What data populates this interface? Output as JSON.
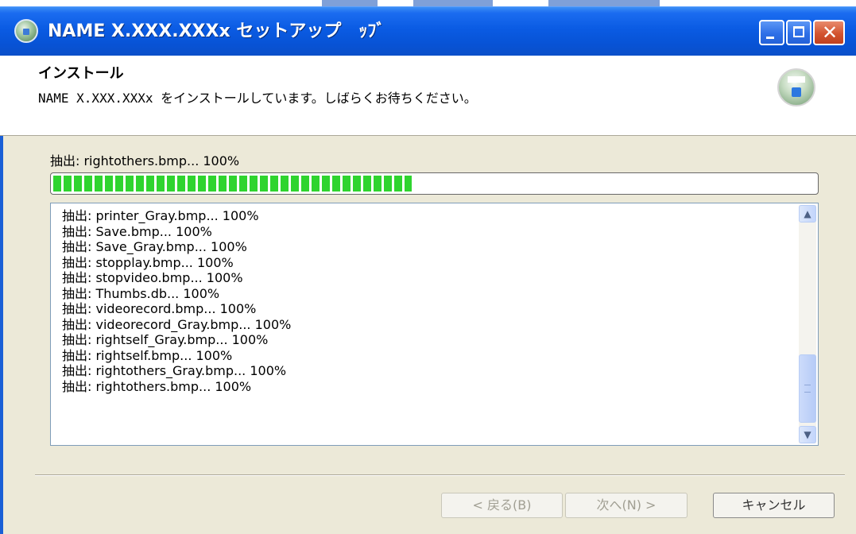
{
  "window": {
    "title": "NAME X.XXX.XXXx セットアップ　ｯﾌﾞ"
  },
  "header": {
    "title": "インストール",
    "subtitle": "NAME X.XXX.XXXx をインストールしています。しばらくお待ちください。"
  },
  "progress": {
    "status": "抽出: rightothers.bmp... 100%",
    "fraction": 0.47
  },
  "log": {
    "lines": [
      "抽出: printer_Gray.bmp... 100%",
      "抽出: Save.bmp... 100%",
      "抽出: Save_Gray.bmp... 100%",
      "抽出: stopplay.bmp... 100%",
      "抽出: stopvideo.bmp... 100%",
      "抽出: Thumbs.db... 100%",
      "抽出: videorecord.bmp... 100%",
      "抽出: videorecord_Gray.bmp... 100%",
      "抽出: rightself_Gray.bmp... 100%",
      "抽出: rightself.bmp... 100%",
      "抽出: rightothers_Gray.bmp... 100%",
      "抽出: rightothers.bmp... 100%"
    ]
  },
  "buttons": {
    "back": "< 戻る(B)",
    "next": "次へ(N) >",
    "cancel": "キャンセル"
  },
  "colors": {
    "titlebar": "#0a5be3",
    "progress_fill": "#2fd42f",
    "dialog_bg": "#ece9d8"
  },
  "icons": {
    "app": "installer-app-icon",
    "header": "installer-disc-icon",
    "minimize": "minimize-icon",
    "maximize": "maximize-icon",
    "close": "close-icon",
    "scroll_up": "chevron-up-icon",
    "scroll_down": "chevron-down-icon"
  }
}
